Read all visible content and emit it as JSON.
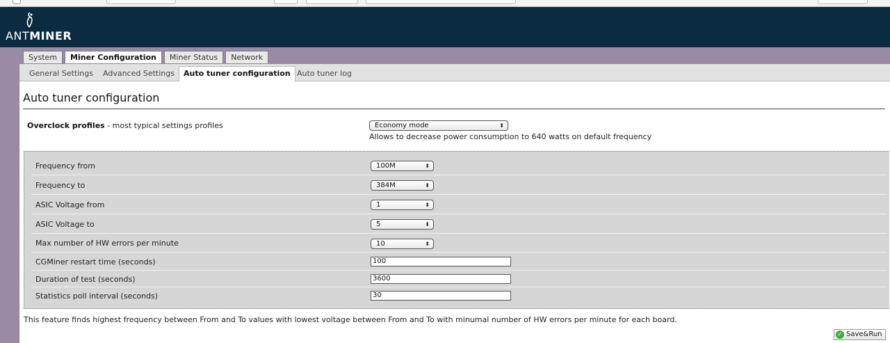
{
  "header": {
    "logo_prefix": "ANT",
    "logo_suffix": "MINER"
  },
  "main_tabs": [
    {
      "label": "System"
    },
    {
      "label": "Miner Configuration"
    },
    {
      "label": "Miner Status"
    },
    {
      "label": "Network"
    }
  ],
  "sub_tabs": [
    {
      "label": "General Settings"
    },
    {
      "label": "Advanced Settings"
    },
    {
      "label": "Auto tuner configuration"
    },
    {
      "label": "Auto tuner log"
    }
  ],
  "page_title": "Auto tuner configuration",
  "overclock": {
    "label": "Overclock profiles",
    "label_suffix": " - most typical settings profiles",
    "selected": "Economy mode",
    "description": "Allows to decrease power consumption to 640 watts on default frequency"
  },
  "settings": {
    "freq_from": {
      "label": "Frequency from",
      "value": "100M"
    },
    "freq_to": {
      "label": "Frequency to",
      "value": "384M"
    },
    "volt_from": {
      "label": "ASIC Voltage from",
      "value": "1"
    },
    "volt_to": {
      "label": "ASIC Voltage to",
      "value": "5"
    },
    "hw_errors": {
      "label": "Max number of HW errors per minute",
      "value": "10"
    },
    "restart_time": {
      "label": "CGMiner restart time (seconds)",
      "value": "100"
    },
    "test_duration": {
      "label": "Duration of test (seconds)",
      "value": "3600"
    },
    "poll_interval": {
      "label": "Statistics poll interval (seconds)",
      "value": "30"
    }
  },
  "footer_note": "This feature finds highest frequency between From and To values with lowest voltage between From and To with minumal number of HW errors per minute for each board.",
  "save_button": "Save&Run",
  "icons": {
    "select_arrows": "⬍",
    "ok": "✓"
  },
  "colors": {
    "header_bg": "#0b2b40",
    "page_bg": "#9a8aa6",
    "settings_bg": "#d6d6d6",
    "save_icon": "#3cae3c"
  }
}
